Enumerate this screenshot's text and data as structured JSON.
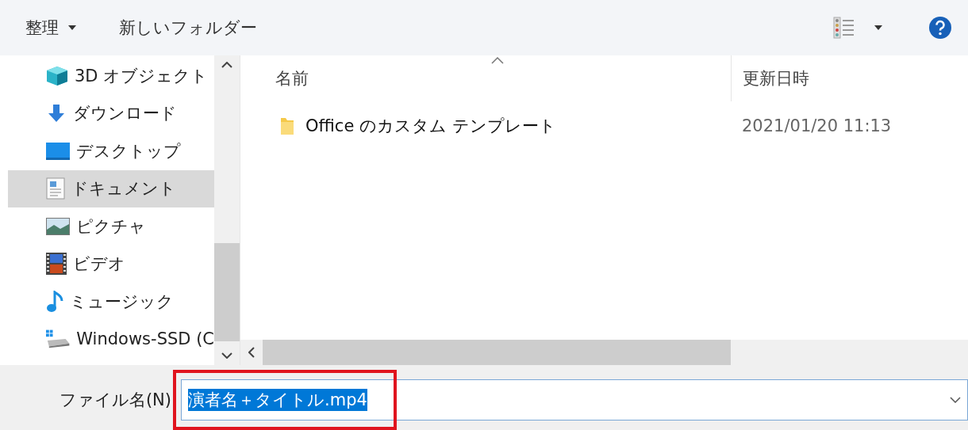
{
  "toolbar": {
    "organize": "整理",
    "new_folder": "新しいフォルダー"
  },
  "sidebar": {
    "items": [
      {
        "label": "3D オブジェクト",
        "kind": "cube",
        "selected": false
      },
      {
        "label": "ダウンロード",
        "kind": "download",
        "selected": false
      },
      {
        "label": "デスクトップ",
        "kind": "desktop",
        "selected": false
      },
      {
        "label": "ドキュメント",
        "kind": "document",
        "selected": true
      },
      {
        "label": "ピクチャ",
        "kind": "picture",
        "selected": false
      },
      {
        "label": "ビデオ",
        "kind": "video",
        "selected": false
      },
      {
        "label": "ミュージック",
        "kind": "music",
        "selected": false
      },
      {
        "label": "Windows-SSD (C",
        "kind": "drive",
        "selected": false
      }
    ]
  },
  "table": {
    "columns": [
      "名前",
      "更新日時"
    ],
    "rows": [
      {
        "name": "Office のカスタム テンプレート",
        "modified": "2021/01/20 11:13"
      }
    ]
  },
  "filename": {
    "label": "ファイル名(N)",
    "value": "演者名＋タイトル.mp4",
    "selected": true,
    "highlighted": true
  }
}
